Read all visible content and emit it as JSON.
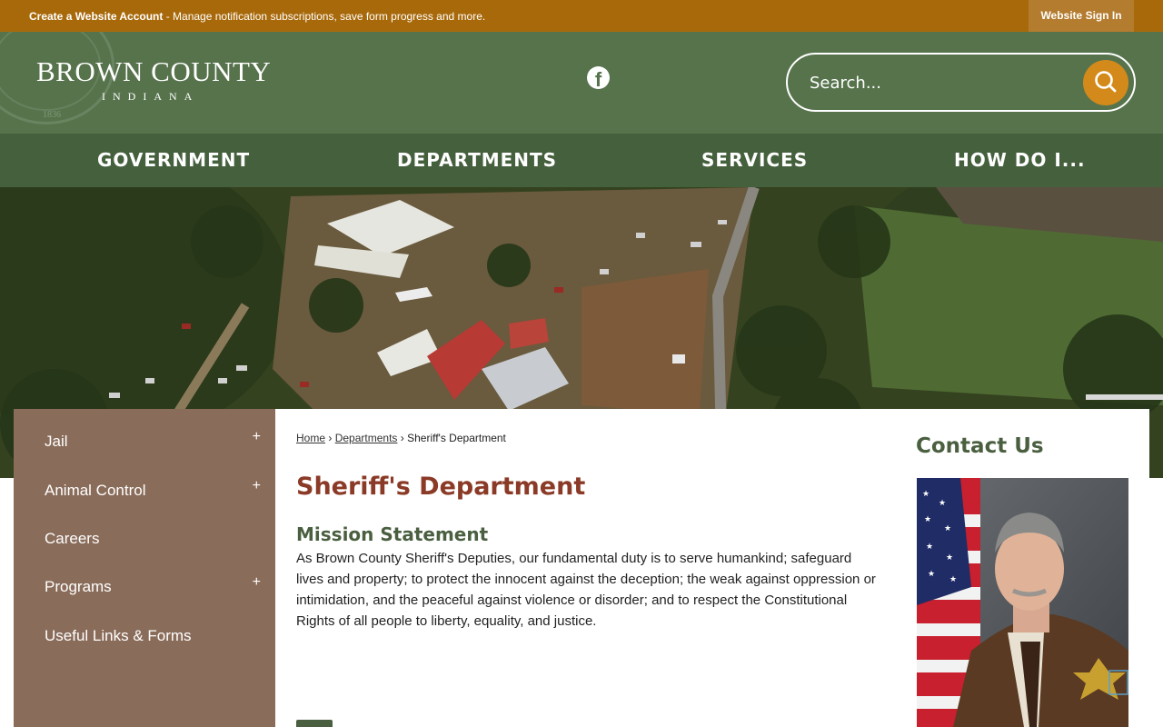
{
  "topbar": {
    "create_account": "Create a Website Account",
    "message": " - Manage notification subscriptions, save form progress and more.",
    "signin": "Website Sign In"
  },
  "header": {
    "site_name": "BROWN COUNTY",
    "state": "INDIANA",
    "seal_year": "1836",
    "facebook_icon": "facebook-icon",
    "search_placeholder": "Search...",
    "search_icon": "search-icon"
  },
  "nav": {
    "items": [
      {
        "label": "GOVERNMENT"
      },
      {
        "label": "DEPARTMENTS"
      },
      {
        "label": "SERVICES"
      },
      {
        "label": "HOW DO I..."
      }
    ]
  },
  "sidebar": {
    "items": [
      {
        "label": "Jail",
        "expander": "+"
      },
      {
        "label": "Animal Control",
        "expander": "+"
      },
      {
        "label": "Careers",
        "expander": ""
      },
      {
        "label": "Programs",
        "expander": "+"
      },
      {
        "label": "Useful Links & Forms",
        "expander": ""
      }
    ]
  },
  "breadcrumb": {
    "home": "Home",
    "sep": "›",
    "departments": "Departments",
    "current": "Sheriff's Department"
  },
  "main": {
    "title": "Sheriff's Department",
    "mission_heading": "Mission Statement",
    "mission_text": "As Brown County Sheriff's Deputies, our fundamental duty is to serve humankind; safeguard lives and property; to protect the innocent against the deception; the weak against oppression or intimidation, and the peaceful against violence or disorder; and to respect the Constitutional Rights of all people to liberty, equality, and justice."
  },
  "contact": {
    "heading": "Contact Us"
  },
  "colors": {
    "topbar": "#a8690a",
    "header": "#56734c",
    "nav": "#45603d",
    "sidebar": "#8a6c5a",
    "title": "#8a3a26",
    "accent_button": "#d48a1a"
  }
}
